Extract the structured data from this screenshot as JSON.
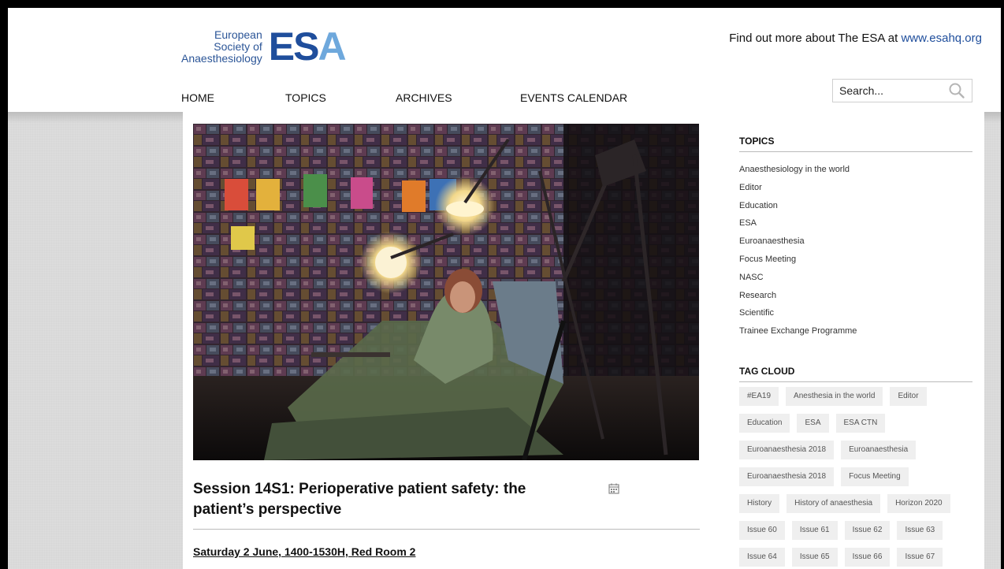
{
  "header": {
    "logo_text_line1": "European",
    "logo_text_line2": "Society of",
    "logo_text_line3": "Anaesthesiology",
    "logo_mark": "ESA",
    "find_more_text": "Find out more about The ESA at ",
    "find_more_link": "www.esahq.org"
  },
  "nav": {
    "items": [
      {
        "label": "HOME"
      },
      {
        "label": "TOPICS"
      },
      {
        "label": "ARCHIVES"
      },
      {
        "label": "EVENTS CALENDAR"
      }
    ]
  },
  "search": {
    "placeholder": "Search...",
    "icon": "search-icon"
  },
  "article": {
    "image_description": "Stage scene",
    "title": "Session 14S1: Perioperative patient safety: the patient’s perspective",
    "date_line": "Saturday 2 June, 1400-1530H, Red Room 2",
    "calendar_icon": "calendar-icon"
  },
  "sidebar": {
    "topics_heading": "TOPICS",
    "topics": [
      "Anaesthesiology in the world",
      "Editor",
      "Education",
      "ESA",
      "Euroanaesthesia",
      "Focus Meeting",
      "NASC",
      "Research",
      "Scientific",
      "Trainee Exchange Programme"
    ],
    "tag_cloud_heading": "TAG CLOUD",
    "tag_rows": [
      [
        "#EA19",
        "Anesthesia in the world",
        "Editor"
      ],
      [
        "Education",
        "ESA",
        "ESA CTN"
      ],
      [
        "Euroanaesthesia 2018",
        "Euroanaesthesia"
      ],
      [
        "Euroanaesthesia 2018",
        "Focus Meeting"
      ],
      [
        "History",
        "History of anaesthesia",
        "Horizon 2020"
      ],
      [
        "Issue 60",
        "Issue 61",
        "Issue 62",
        "Issue 63"
      ],
      [
        "Issue 64",
        "Issue 65",
        "Issue 66",
        "Issue 67"
      ]
    ]
  },
  "colors": {
    "brand_blue": "#1f4e9c",
    "brand_light_blue": "#6ea8dc",
    "page_bg": "#dcdcdc",
    "tag_bg": "#efefef"
  }
}
